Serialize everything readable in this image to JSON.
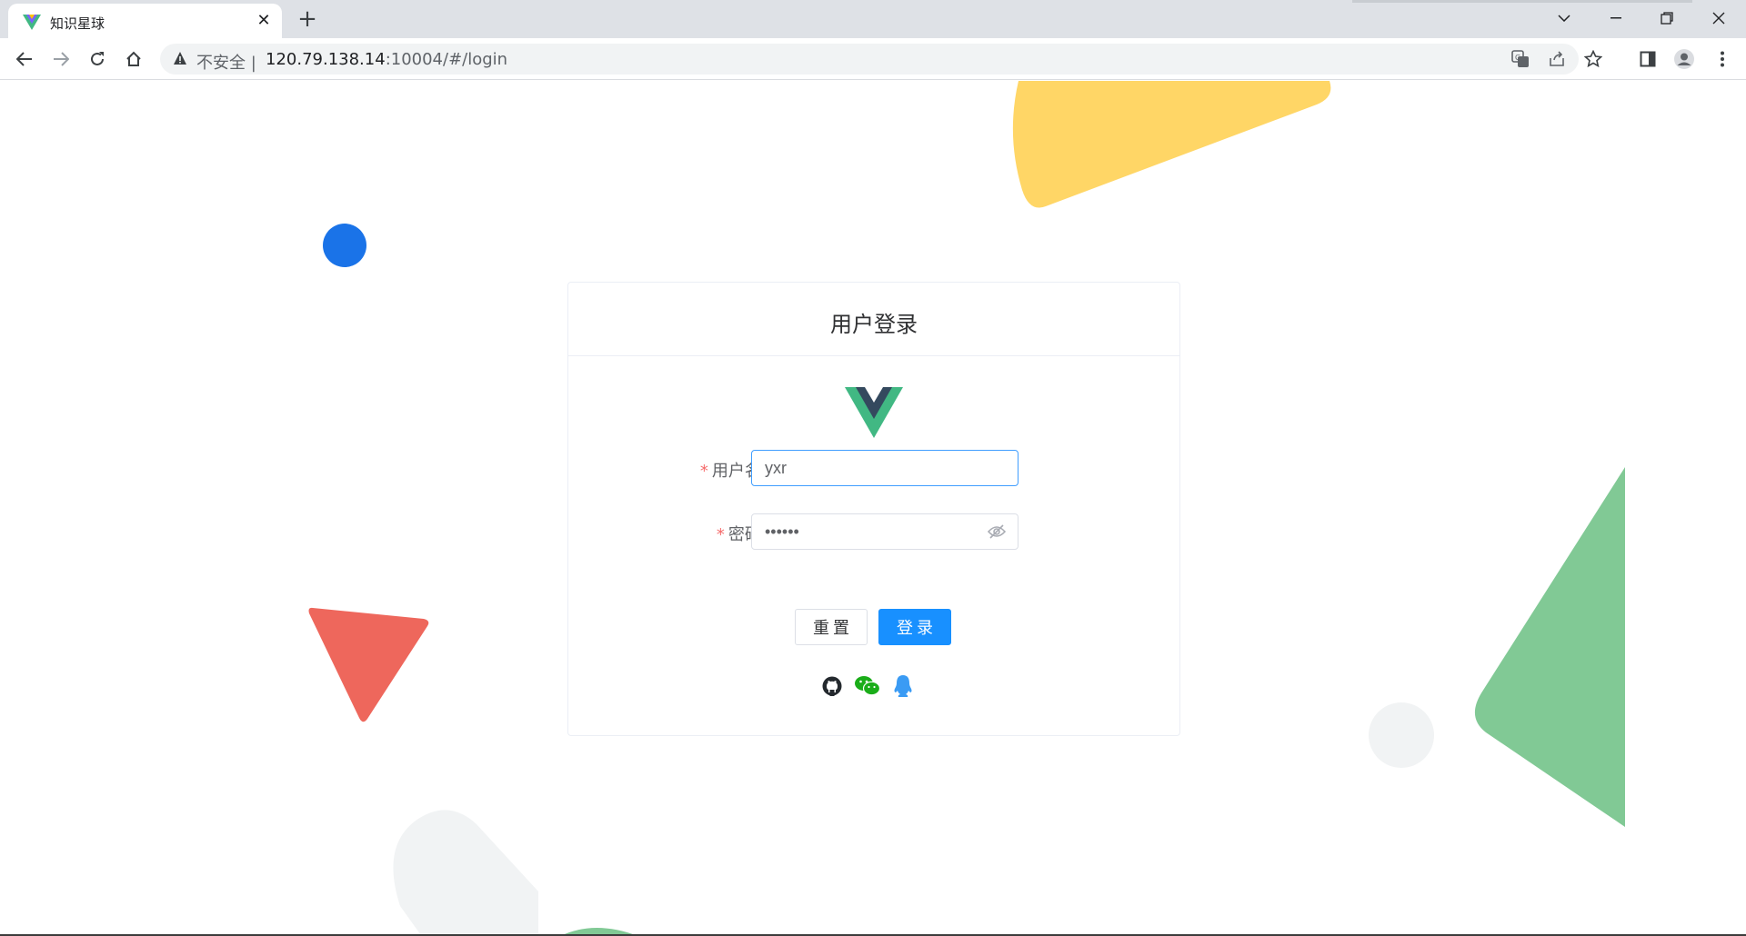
{
  "browser": {
    "tab_title": "知识星球",
    "tab_close": "✕",
    "new_tab": "+",
    "insecure_label": "不安全 |",
    "url_host": "120.79.138.14",
    "url_rest": ":10004/#/login"
  },
  "login": {
    "title": "用户登录",
    "username_label": "用户名:",
    "username_value": "yxr",
    "password_label": "密码:",
    "password_value": "••••••",
    "reset_label": "重置",
    "login_label": "登录",
    "required_mark": "*"
  },
  "colors": {
    "accent": "#1890ff",
    "focus": "#409eff",
    "required": "#f56c6c",
    "deco_yellow": "#ffd666",
    "deco_blue": "#1a73e8",
    "deco_red": "#ee675c",
    "deco_green": "#81c995",
    "deco_gray": "#f1f3f4"
  }
}
